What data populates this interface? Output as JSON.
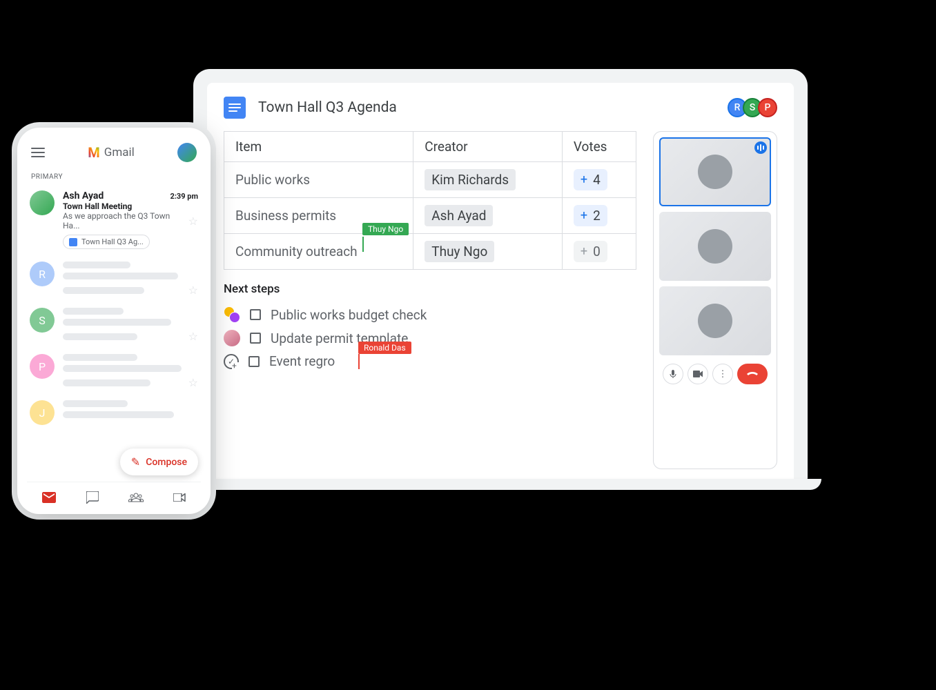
{
  "laptop": {
    "doc_title": "Town Hall Q3 Agenda",
    "collaborators": [
      {
        "initial": "R",
        "color": "blue"
      },
      {
        "initial": "S",
        "color": "green"
      },
      {
        "initial": "P",
        "color": "red"
      }
    ],
    "table": {
      "headers": {
        "item": "Item",
        "creator": "Creator",
        "votes": "Votes"
      },
      "rows": [
        {
          "item": "Public works",
          "creator": "Kim Richards",
          "votes": "4"
        },
        {
          "item": "Business permits",
          "creator": "Ash Ayad",
          "votes": "2"
        },
        {
          "item": "Community outreach",
          "creator": "Thuy Ngo",
          "votes": "0"
        }
      ]
    },
    "cursors": {
      "green": "Thuy Ngo",
      "red": "Ronald Das"
    },
    "next_steps": {
      "title": "Next steps",
      "items": [
        {
          "text": "Public works budget check"
        },
        {
          "text": "Update permit template"
        },
        {
          "text": "Event regro"
        }
      ]
    },
    "meet": {
      "controls": {
        "mic": "mic",
        "video": "video",
        "more": "more",
        "end": "end-call"
      }
    }
  },
  "phone": {
    "app_name": "Gmail",
    "tab": "PRIMARY",
    "featured_email": {
      "sender": "Ash Ayad",
      "time": "2:39 pm",
      "subject": "Town Hall Meeting",
      "snippet": "As we approach the Q3 Town Ha...",
      "attachment": "Town Hall Q3 Ag..."
    },
    "skeleton_avatars": [
      "R",
      "S",
      "P",
      "J"
    ],
    "compose": "Compose"
  }
}
